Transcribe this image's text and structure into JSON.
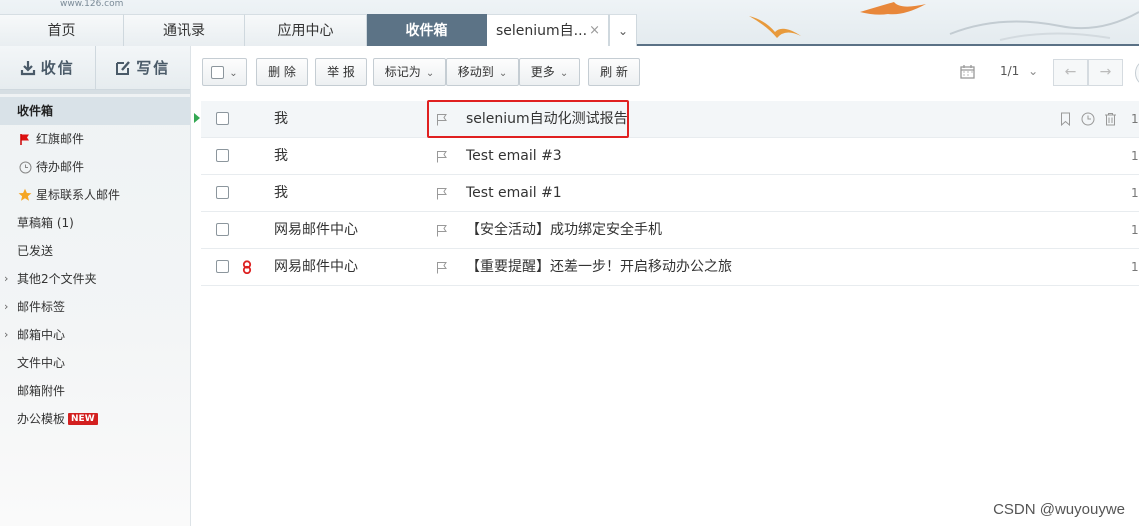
{
  "header": {
    "logo_text": "www.126.com",
    "tabs": [
      {
        "label": "首页"
      },
      {
        "label": "通讯录"
      },
      {
        "label": "应用中心"
      },
      {
        "label": "收件箱"
      },
      {
        "label": "selenium自..."
      }
    ],
    "close_glyph": "×",
    "more_glyph": "⌄",
    "active_tab": "收件箱"
  },
  "sidebar": {
    "receive_label": "收信",
    "compose_label": "写信",
    "folders": [
      {
        "label": "收件箱",
        "icon": null
      },
      {
        "label": "红旗邮件",
        "icon": "red-flag-icon"
      },
      {
        "label": "待办邮件",
        "icon": "clock-icon"
      },
      {
        "label": "星标联系人邮件",
        "icon": "star-icon"
      },
      {
        "label": "草稿箱 (1)",
        "icon": null
      },
      {
        "label": "已发送",
        "icon": null
      },
      {
        "label": "其他2个文件夹",
        "icon": "chevron-right-icon"
      },
      {
        "label": "邮件标签",
        "icon": "chevron-right-icon"
      },
      {
        "label": "邮箱中心",
        "icon": "chevron-right-icon"
      },
      {
        "label": "文件中心",
        "icon": null
      },
      {
        "label": "邮箱附件",
        "icon": null
      },
      {
        "label": "办公模板",
        "icon": null,
        "badge": "NEW"
      }
    ]
  },
  "toolbar": {
    "delete_label": "删 除",
    "report_label": "举 报",
    "mark_label": "标记为",
    "move_label": "移动到",
    "more_label": "更多",
    "refresh_label": "刷 新",
    "page_indicator": "1/1"
  },
  "emails": [
    {
      "from": "我",
      "subject": "selenium自动化测试报告",
      "tail": "1",
      "selected": true
    },
    {
      "from": "我",
      "subject": "Test email #3",
      "tail": "1"
    },
    {
      "from": "我",
      "subject": "Test email #1",
      "tail": "1"
    },
    {
      "from": "网易邮件中心",
      "subject": "【安全活动】成功绑定安全手机",
      "tail": "1"
    },
    {
      "from": "网易邮件中心",
      "subject": "【重要提醒】还差一步！开启移动办公之旅",
      "tail": "1",
      "icon": "red-subscription-icon"
    }
  ],
  "colors": {
    "active_tab": "#5c7386",
    "highlight_box": "#e02020",
    "new_badge": "#d32020"
  },
  "watermark": "CSDN @wuyouywe"
}
